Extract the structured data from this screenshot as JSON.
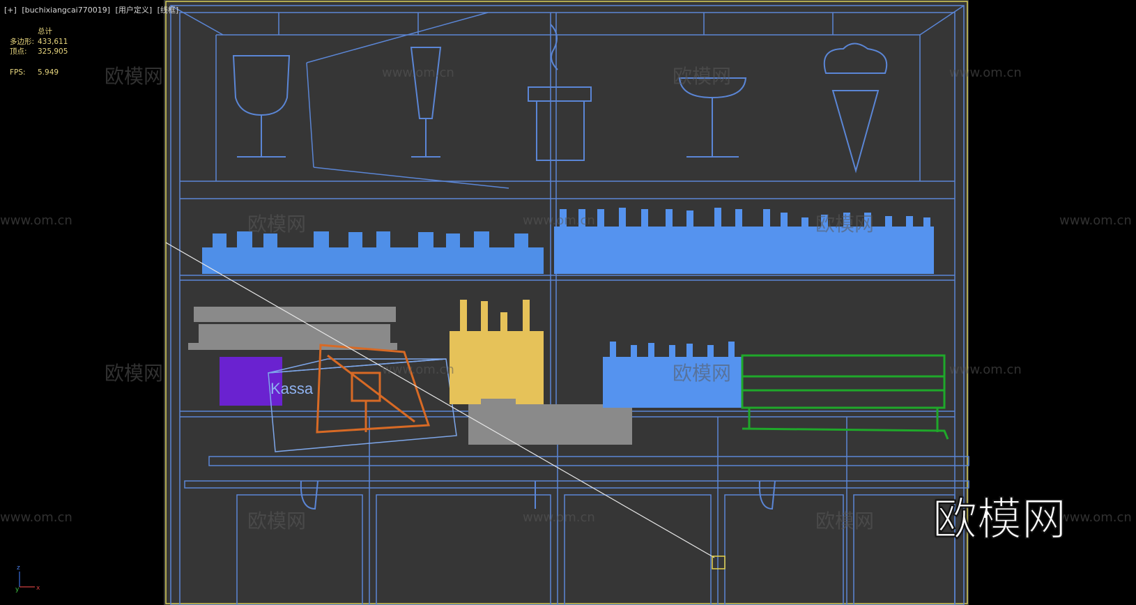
{
  "viewport": {
    "label_items": [
      "[+]",
      "[buchixiangcai770019]",
      "[用户定义]",
      "[线框]"
    ]
  },
  "stats": {
    "title": "总计",
    "polygons_label": "多边形:",
    "polygons_value": "433,611",
    "vertices_label": "顶点:",
    "vertices_value": "325,905",
    "fps_label": "FPS:",
    "fps_value": "5.949"
  },
  "scene": {
    "kassa_text": "Kassa",
    "colors": {
      "background": "#363636",
      "frame": "#5b86d6",
      "glass_items": "#4f8fe8",
      "bottles": "#5593ef",
      "appliance": "#8a8a8a",
      "yellow_taps": "#e6c259",
      "purple_box": "#6a22d0",
      "orange_item": "#d86a25",
      "green_rack": "#1fa82a",
      "selection_border": "#d8cf58"
    }
  },
  "axis_gizmo": {
    "x": "x",
    "y": "y",
    "z": "z"
  },
  "watermarks": {
    "cn": "欧模网",
    "url": "www.om.cn",
    "logo": "欧模网"
  }
}
